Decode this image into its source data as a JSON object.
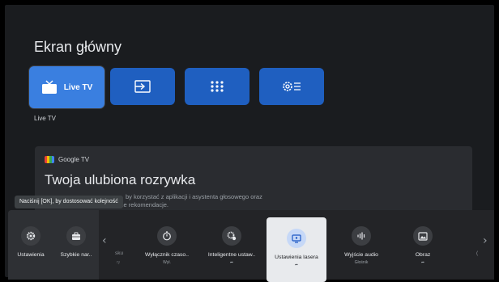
{
  "home": {
    "title": "Ekran główny",
    "apps": [
      {
        "label": "Live TV",
        "icon": "tv-icon"
      },
      {
        "label": "",
        "icon": "input-icon"
      },
      {
        "label": "",
        "icon": "apps-grid-icon"
      },
      {
        "label": "",
        "icon": "settings-list-icon"
      }
    ],
    "focused_app_caption": "Live TV"
  },
  "google_tv_card": {
    "brand": "Google TV",
    "headline": "Twoja ulubiona rozrywka",
    "body_line1": "by korzystać z aplikacji i asystenta głosowego oraz",
    "body_line2": "otrzymywać spersonalizowane rekomendacje."
  },
  "tooltip": "Naciśnij [OK], by dostosować kolejność",
  "quick_settings": {
    "pinned": [
      {
        "label": "Ustawienia",
        "icon": "gear-icon"
      },
      {
        "label": "Szybkie nar..",
        "icon": "toolbox-icon"
      }
    ],
    "partial_left": {
      "label": "sku",
      "sub": "ry"
    },
    "items": [
      {
        "label": "Wyłącznik czaso..",
        "sub": "Wył.",
        "icon": "timer-icon"
      },
      {
        "label": "Inteligentne ustaw..",
        "sub": "",
        "icon": "smart-settings-icon",
        "has_arrow": true
      },
      {
        "label": "Ustawienia lasera",
        "sub": "",
        "icon": "laser-screen-icon",
        "has_arrow": true,
        "focused": true
      },
      {
        "label": "Wyjście audio",
        "sub": "Głośnik",
        "icon": "audio-output-icon"
      },
      {
        "label": "Obraz",
        "sub": "",
        "icon": "picture-icon",
        "has_arrow": true
      }
    ],
    "partial_right": {
      "label": "("
    }
  },
  "colors": {
    "tile_blue": "#1f5fc0",
    "tile_focused": "#3a7fe0",
    "panel_bg": "#232427",
    "focused_card": "#e8eaed"
  }
}
